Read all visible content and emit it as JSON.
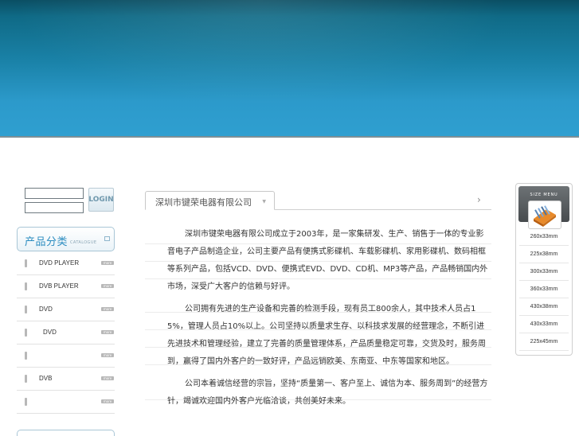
{
  "login": {
    "button_label": "LOGIN"
  },
  "category": {
    "title": "产品分类",
    "subtitle": "CATALOGUE",
    "more_label": "more",
    "items": [
      {
        "label": "DVD PLAYER"
      },
      {
        "label": "DVB PLAYER"
      },
      {
        "label": "DVD"
      },
      {
        "label": "DVD"
      },
      {
        "label": ""
      },
      {
        "label": "DVB"
      },
      {
        "label": ""
      }
    ]
  },
  "main": {
    "tab_label": "深圳市键荣电器有限公司",
    "paragraphs": [
      "深圳市键荣电器有限公司成立于2003年，是一家集研发、生产、销售于一体的专业影音电子产品制造企业，公司主要产品有便携式影碟机、车载影碟机、家用影碟机、数码相框等系列产品，包括VCD、DVD、便携式EVD、DVD、CD机、MP3等产品，产品畅销国内外市场，深受广大客户的信赖与好评。",
      "公司拥有先进的生产设备和完善的检测手段，现有员工800余人，其中技术人员占15%，管理人员占10%以上。公司坚持以质量求生存、以科技求发展的经营理念，不断引进先进技术和管理经验，建立了完善的质量管理体系，产品质量稳定可靠，交货及时，服务周到，赢得了国内外客户的一致好评，产品远销欧美、东南亚、中东等国家和地区。",
      "公司本着诚信经营的宗旨，坚持“质量第一、客户至上、诚信为本、服务周到”的经营方针，竭诚欢迎国内外客户光临洽谈，共创美好未来。"
    ]
  },
  "size_menu": {
    "title": "SIZE MENU",
    "items": [
      "260x33mm",
      "225x38mm",
      "300x33mm",
      "360x33mm",
      "430x38mm",
      "430x33mm",
      "225x45mm"
    ]
  }
}
